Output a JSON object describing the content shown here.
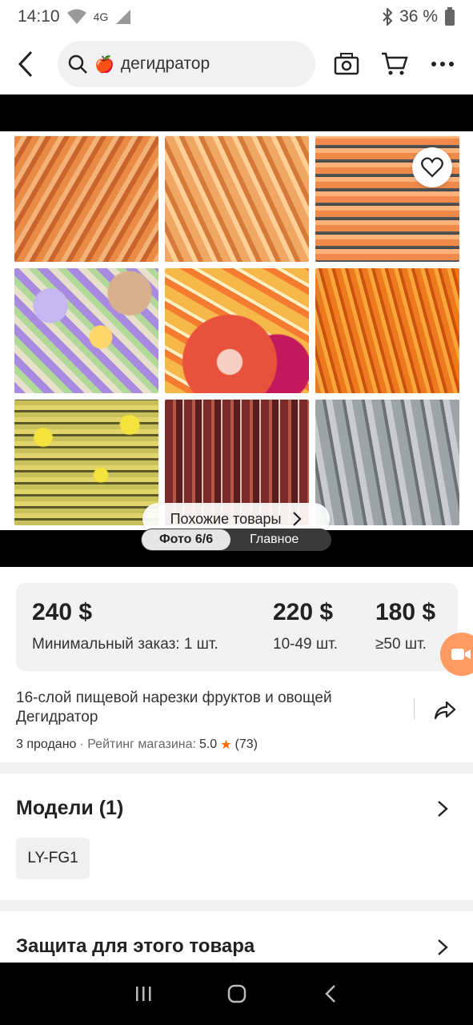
{
  "status_bar": {
    "time": "14:10",
    "network": "4G",
    "battery": "36 %"
  },
  "search": {
    "emoji": "🍎",
    "query": "дегидратор"
  },
  "gallery": {
    "similar_label": "Похожие товары",
    "photo_counter": "Фото 6/6",
    "main_tab": "Главное"
  },
  "prices": [
    {
      "price": "240 $",
      "note": "Минимальный заказ: 1 шт."
    },
    {
      "price": "220 $",
      "note": "10-49 шт."
    },
    {
      "price": "180 $",
      "note": "≥50 шт."
    }
  ],
  "product": {
    "title": "16-слой пищевой нарезки фруктов и овощей Дегидратор",
    "sold": "3 продано",
    "rating_label": "· Рейтинг магазина:",
    "rating": "5.0",
    "reviews": "(73)"
  },
  "models": {
    "title": "Модели (1)",
    "chip": "LY-FG1"
  },
  "protection": {
    "title": "Защита для этого товара"
  },
  "colors": {
    "accent": "#ff6a00",
    "chat_fab": "#ff9a63",
    "card_bg": "#f2f2f2"
  }
}
